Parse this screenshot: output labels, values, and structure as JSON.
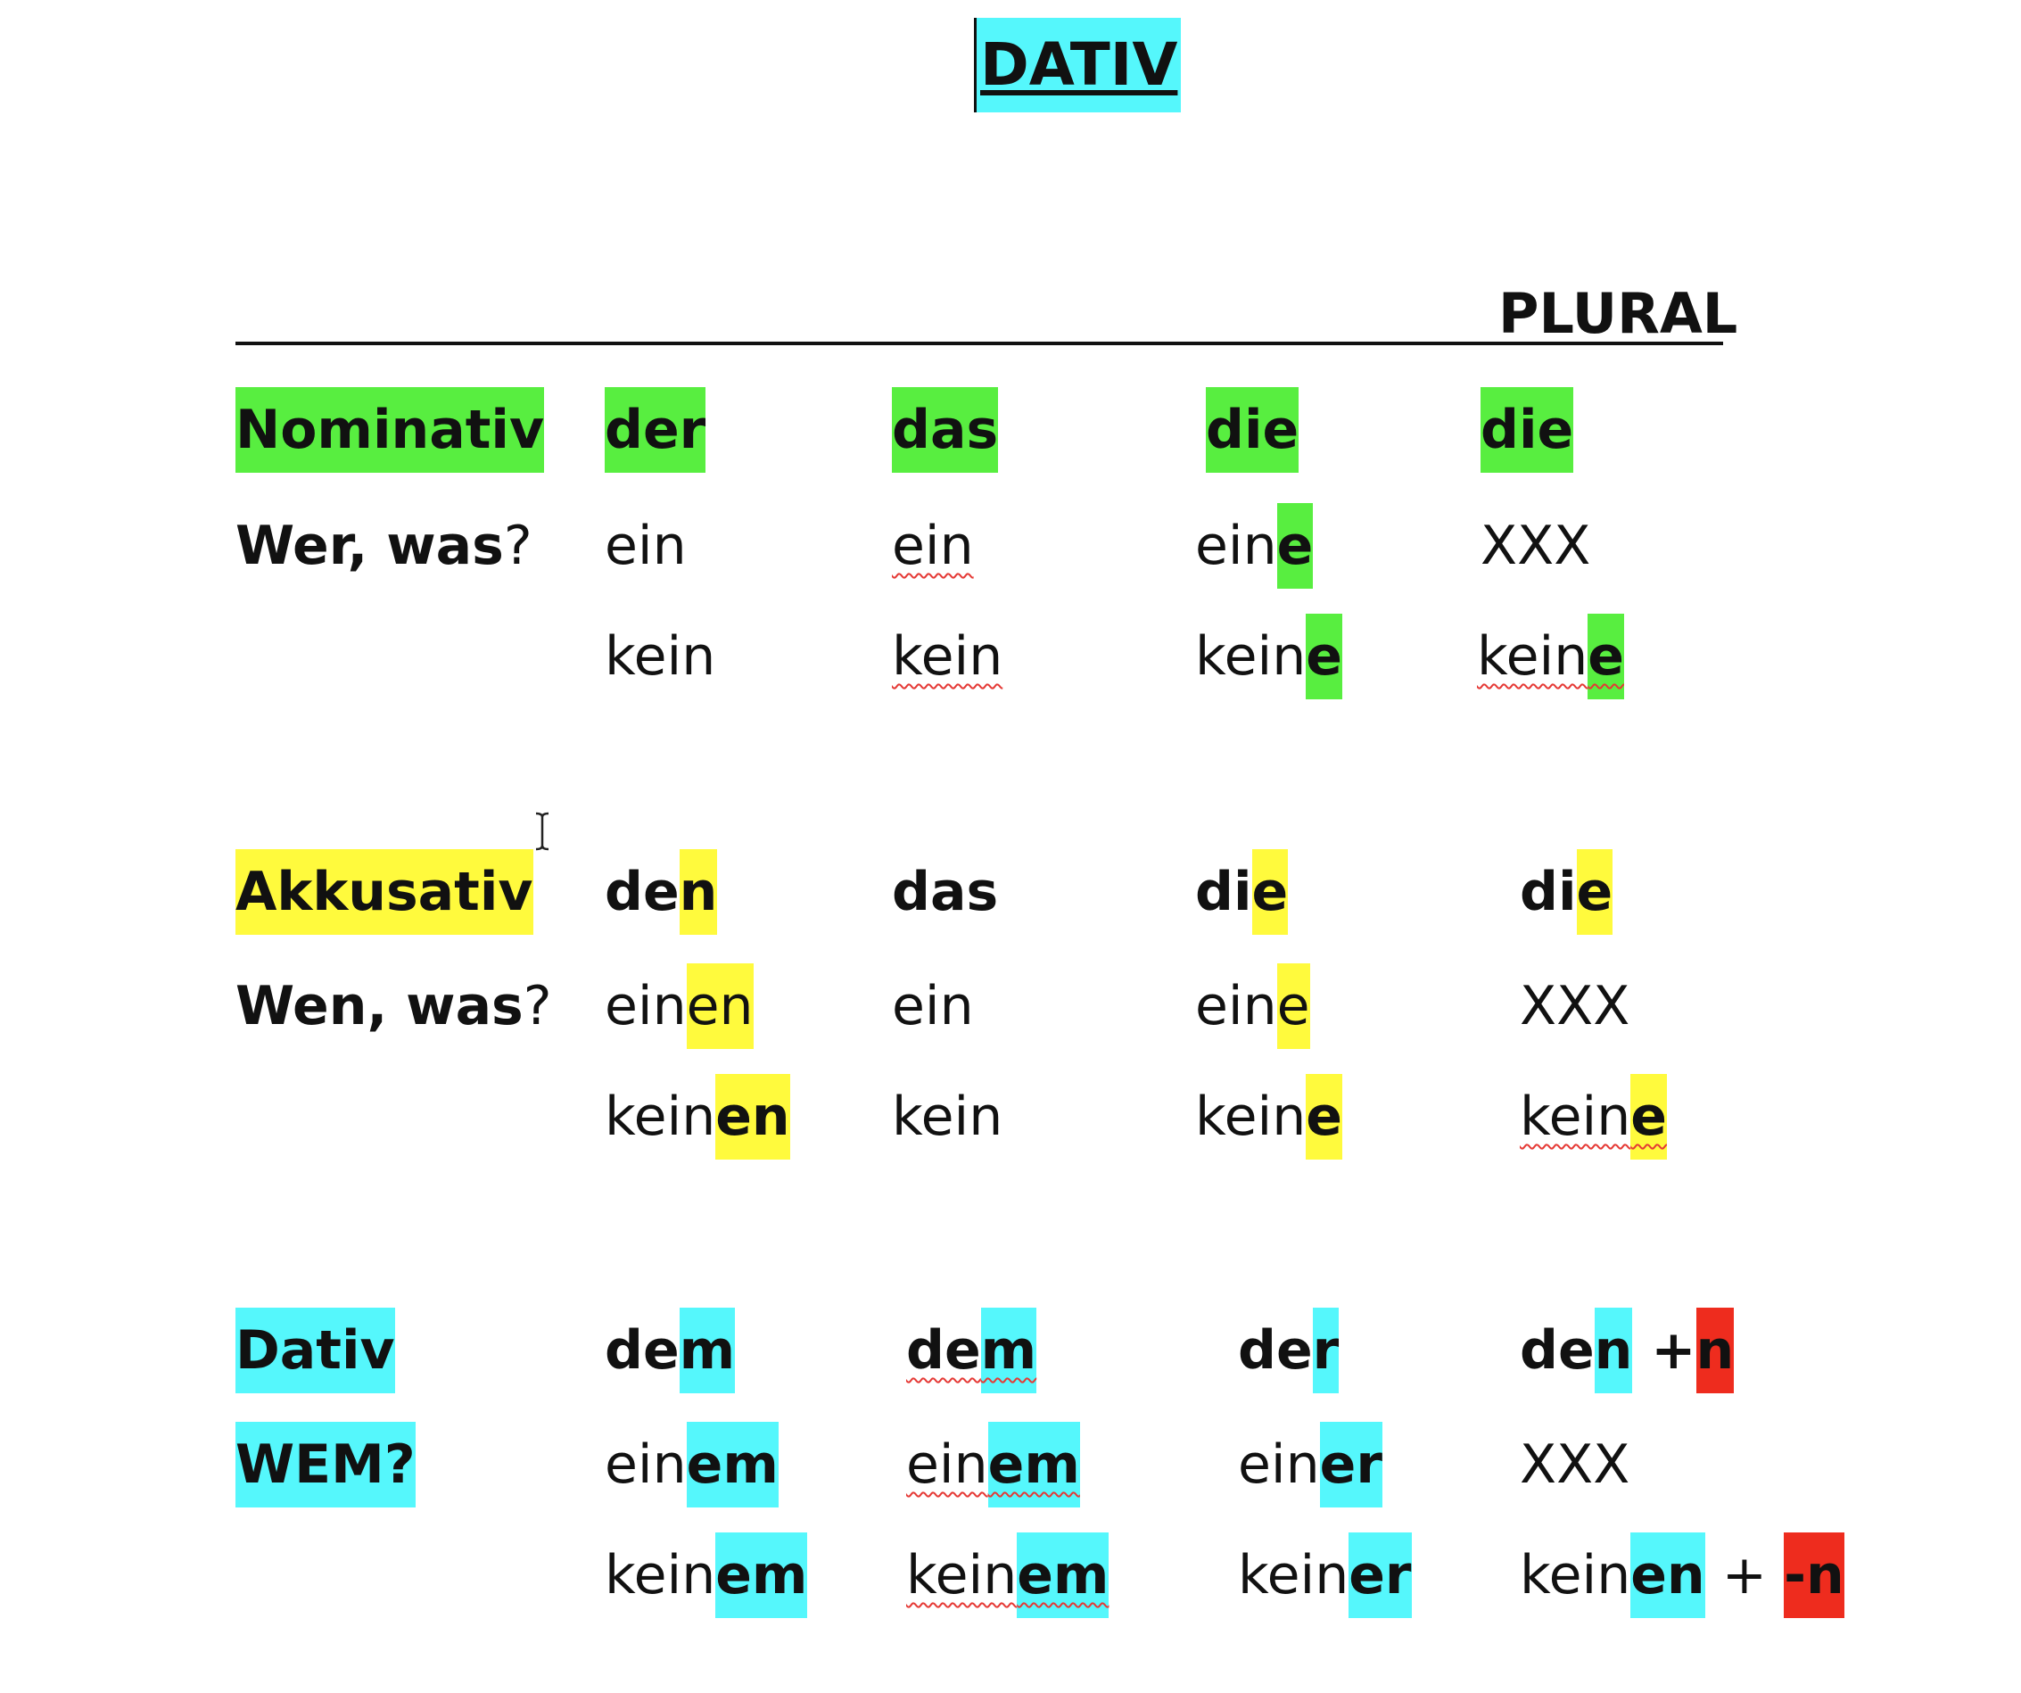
{
  "document": {
    "title": "DATIV",
    "plural_heading": "PLURAL"
  },
  "cases": {
    "nominativ": {
      "label": "Nominativ",
      "question_main": "Wer, was",
      "question_mark": "?",
      "col1": {
        "definite": "der",
        "indef_stem": "ein",
        "neg_stem": "kein"
      },
      "col2": {
        "definite": "das",
        "indef_stem": "ein",
        "neg_stem": "kein"
      },
      "col3": {
        "definite": "die",
        "indef_stem": "ein",
        "indef_end": "e",
        "neg_stem": "kein",
        "neg_end": "e"
      },
      "col4": {
        "definite": "die",
        "indef": "XXX",
        "neg_stem": "kein",
        "neg_end": "e"
      }
    },
    "akkusativ": {
      "label": "Akkusativ",
      "question_main": "Wen, was",
      "question_mark": "?",
      "col1": {
        "def_stem": "de",
        "def_end": "n",
        "indef_stem": "ein",
        "indef_end": "en",
        "neg_stem": "kein",
        "neg_end": "en"
      },
      "col2": {
        "definite": "das",
        "indef": "ein",
        "neg": "kein"
      },
      "col3": {
        "def_stem": "di",
        "def_end": "e",
        "indef_stem": "ein",
        "indef_end": "e",
        "neg_stem": "kein",
        "neg_end": "e"
      },
      "col4": {
        "def_stem": "di",
        "def_end": "e",
        "indef": "XXX",
        "neg_stem": "kein",
        "neg_end": "e"
      }
    },
    "dativ": {
      "label": "Dativ",
      "question": "WEM?",
      "col1": {
        "def_stem": "de",
        "def_end": "m",
        "indef_stem": "ein",
        "indef_end": "em",
        "neg_stem": "kein",
        "neg_end": "em"
      },
      "col2": {
        "def_stem": "de",
        "def_end": "m",
        "indef_stem": "ein",
        "indef_end": "em",
        "neg_stem": "kein",
        "neg_end": "em"
      },
      "col3": {
        "def_stem": "de",
        "def_end": "r",
        "indef_stem": "ein",
        "indef_end": "er",
        "neg_stem": "kein",
        "neg_end": "er"
      },
      "col4": {
        "def_stem": "de",
        "def_end": "n",
        "def_plus": " +",
        "def_n": "n",
        "indef": "XXX",
        "neg_stem": "kein",
        "neg_end": "en",
        "neg_plus": " + ",
        "neg_n": "-n"
      }
    }
  },
  "colors": {
    "nominativ": "#58ee40",
    "akkusativ": "#fffa3d",
    "dativ": "#55f7fc",
    "plural_n": "#ee2c1e"
  },
  "icons": {
    "cursor": "text-cursor-icon"
  }
}
